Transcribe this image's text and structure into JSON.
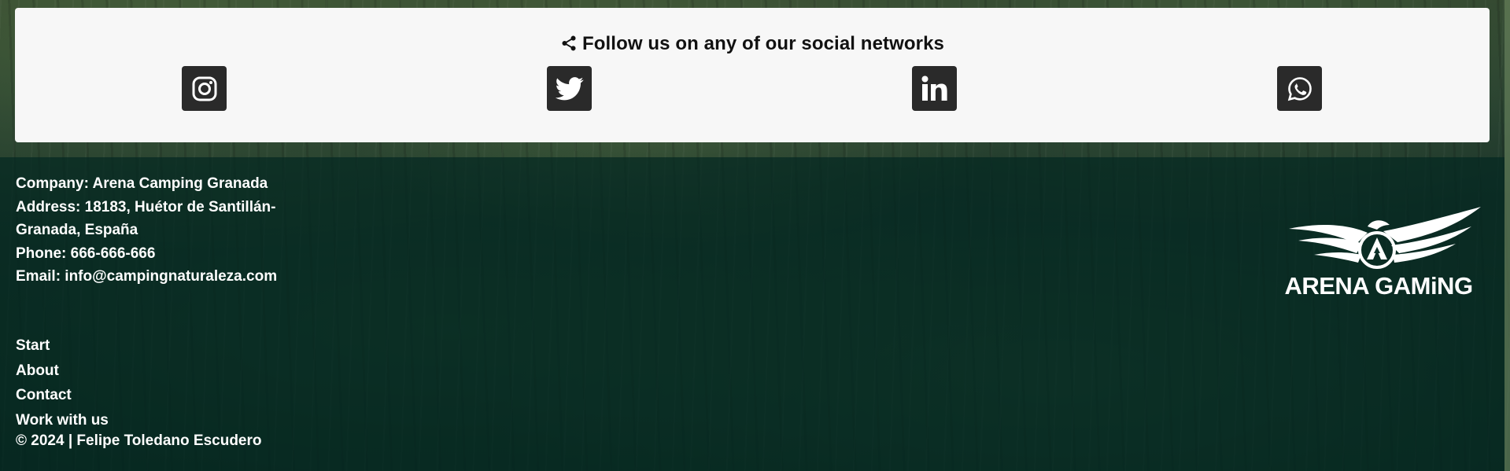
{
  "social": {
    "title": "Follow us on any of our social networks",
    "icons": [
      "share-icon",
      "instagram-icon",
      "twitter-icon",
      "linkedin-icon",
      "whatsapp-icon"
    ]
  },
  "company": {
    "company_line": "Company: Arena Camping Granada",
    "address_line1": "Address: 18183, Huétor de Santillán-",
    "address_line2": "Granada, España",
    "phone_line": "Phone: 666-666-666",
    "email_line": "Email: info@campingnaturaleza.com"
  },
  "nav": {
    "items": [
      "Start",
      "About",
      "Contact",
      "Work with us"
    ]
  },
  "footer": {
    "copyright": "© 2024 | Felipe Toledano Escudero"
  },
  "logo": {
    "text": "ARENA GAMiNG"
  },
  "colors": {
    "card_bg": "#f7f7f7",
    "icon_bg": "#2a2a2a",
    "footer_bg": "#042821"
  }
}
